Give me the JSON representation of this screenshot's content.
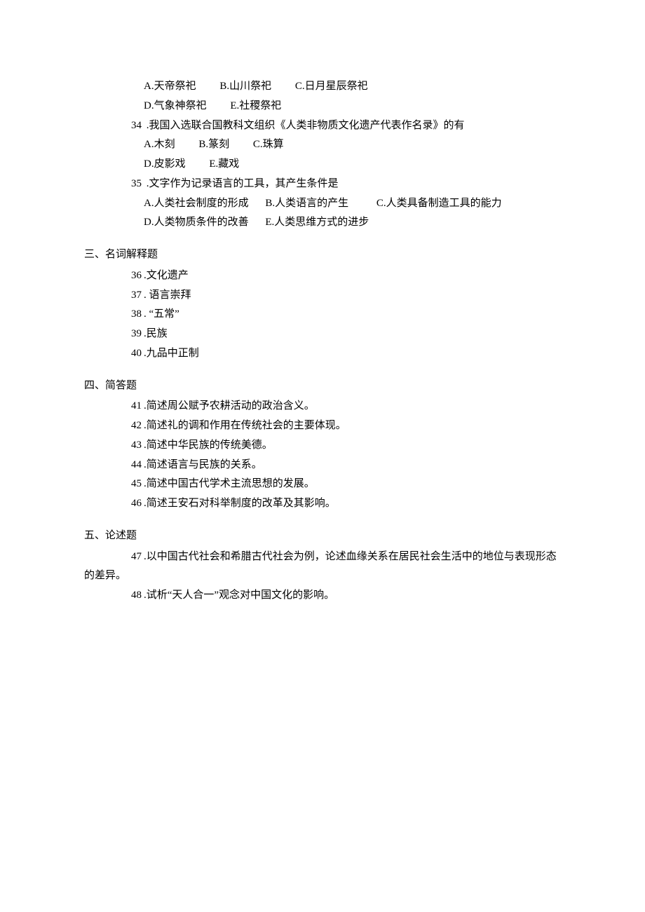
{
  "q33": {
    "options": {
      "A": "A.天帝祭祀",
      "B": "B.山川祭祀",
      "C": "C.日月星辰祭祀",
      "D": "D.气象神祭祀",
      "E": "E.社稷祭祀"
    }
  },
  "q34": {
    "num": "34",
    "text": ".我国入选联合国教科文组织《人类非物质文化遗产代表作名录》的有",
    "options": {
      "A": "A.木刻",
      "B": "B.篆刻",
      "C": "C.珠算",
      "D": "D.皮影戏",
      "E": "E.藏戏"
    }
  },
  "q35": {
    "num": "35",
    "text": ".文字作为记录语言的工具，其产生条件是",
    "options": {
      "A": "A.人类社会制度的形成",
      "B": "B.人类语言的产生",
      "C": "C.人类具备制造工具的能力",
      "D": "D.人类物质条件的改善",
      "E": "E.人类思维方式的进步"
    }
  },
  "section3": {
    "heading": "三、名词解释题",
    "items": [
      {
        "num": "36",
        "text": ".文化遗产"
      },
      {
        "num": "37",
        "text": ". 语言崇拜"
      },
      {
        "num": "38",
        "text": ". “五常”"
      },
      {
        "num": "39",
        "text": ".民族"
      },
      {
        "num": "40",
        "text": ".九品中正制"
      }
    ]
  },
  "section4": {
    "heading": "四、简答题",
    "items": [
      {
        "num": "41",
        "text": ".简述周公赋予农耕活动的政治含义。"
      },
      {
        "num": "42",
        "text": ".简述礼的调和作用在传统社会的主要体现。"
      },
      {
        "num": "43",
        "text": ".简述中华民族的传统美德。"
      },
      {
        "num": "44",
        "text": ".简述语言与民族的关系。"
      },
      {
        "num": "45",
        "text": ".简述中国古代学术主流思想的发展。"
      },
      {
        "num": "46",
        "text": ".简述王安石对科举制度的改革及其影响。"
      }
    ]
  },
  "section5": {
    "heading": "五、论述题",
    "items": [
      {
        "num": "47",
        "text": ".以中国古代社会和希腊古代社会为例，论述血缘关系在居民社会生活中的地位与表现形态的差异。"
      },
      {
        "num": "48",
        "text": ".试析“天人合一”观念对中国文化的影响。"
      }
    ]
  }
}
